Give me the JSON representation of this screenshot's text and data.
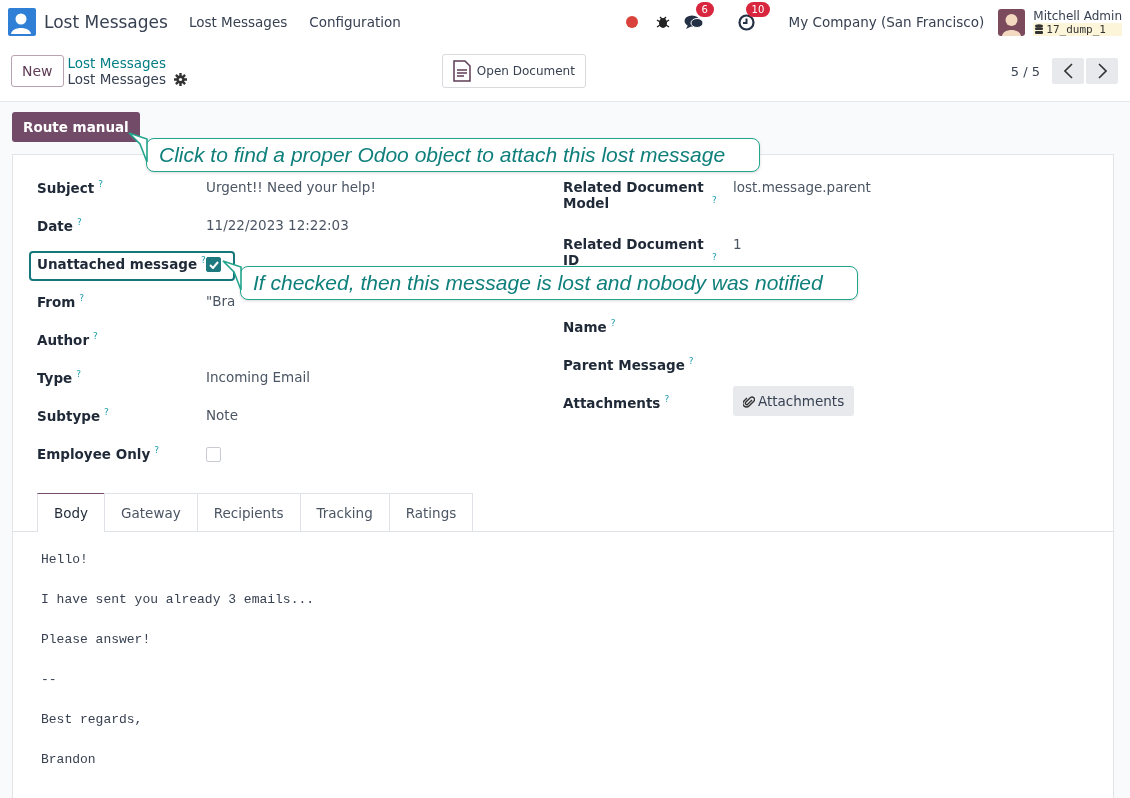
{
  "app": {
    "name": "Lost Messages"
  },
  "menu": [
    {
      "label": "Lost Messages"
    },
    {
      "label": "Configuration"
    }
  ],
  "systray": {
    "chat_count": "6",
    "activity_count": "10",
    "company": "My Company (San Francisco)",
    "user": "Mitchell Admin",
    "database": "17_dump_1"
  },
  "control_panel": {
    "new_button": "New",
    "breadcrumb": "Lost Messages",
    "title": "Lost Messages",
    "action": "Open Document",
    "pager": "5 / 5"
  },
  "header_button": {
    "label": "Route manual",
    "tip": "Click to find a proper Odoo object to attach this lost message"
  },
  "left_fields": [
    {
      "kind": "text",
      "label": "Subject",
      "help": "?",
      "value": "Urgent!! Need your help!"
    },
    {
      "kind": "text",
      "label": "Date",
      "help": "?",
      "value": "11/22/2023 12:22:03"
    },
    {
      "kind": "checkbox",
      "label": "Unattached message",
      "help": "?",
      "checked": true,
      "highlighted": true,
      "tip": "If checked, then this message is lost and nobody was notified"
    },
    {
      "kind": "text",
      "label": "From",
      "help": "?",
      "value": "\"Bra"
    },
    {
      "kind": "text",
      "label": "Author",
      "help": "?"
    },
    {
      "kind": "text",
      "label": "Type",
      "help": "?",
      "value": "Incoming Email"
    },
    {
      "kind": "text",
      "label": "Subtype",
      "help": "?",
      "value": "Note"
    },
    {
      "kind": "checkbox",
      "label": "Employee Only",
      "help": "?",
      "checked": false,
      "highlighted": false
    }
  ],
  "right_fields": [
    {
      "kind": "text",
      "label": "Related Document Model",
      "help": "?",
      "value": "lost.message.parent"
    },
    {
      "kind": "text",
      "label": "Related Document ID",
      "help": "?",
      "value": "1"
    },
    {
      "kind": "text",
      "label": "Name",
      "help": "?"
    },
    {
      "kind": "text",
      "label": "Parent Message",
      "help": "?"
    },
    {
      "kind": "button",
      "label": "Attachments",
      "help": "?",
      "value": "Attachments"
    }
  ],
  "tabs": [
    {
      "label": "Body",
      "selected": true
    },
    {
      "label": "Gateway",
      "selected": false
    },
    {
      "label": "Recipients",
      "selected": false
    },
    {
      "label": "Tracking",
      "selected": false
    },
    {
      "label": "Ratings",
      "selected": false
    }
  ],
  "body_lines": [
    "Hello!",
    "I have sent you already 3 emails...",
    "Please answer!",
    "--",
    "Best regards,",
    "Brandon"
  ]
}
